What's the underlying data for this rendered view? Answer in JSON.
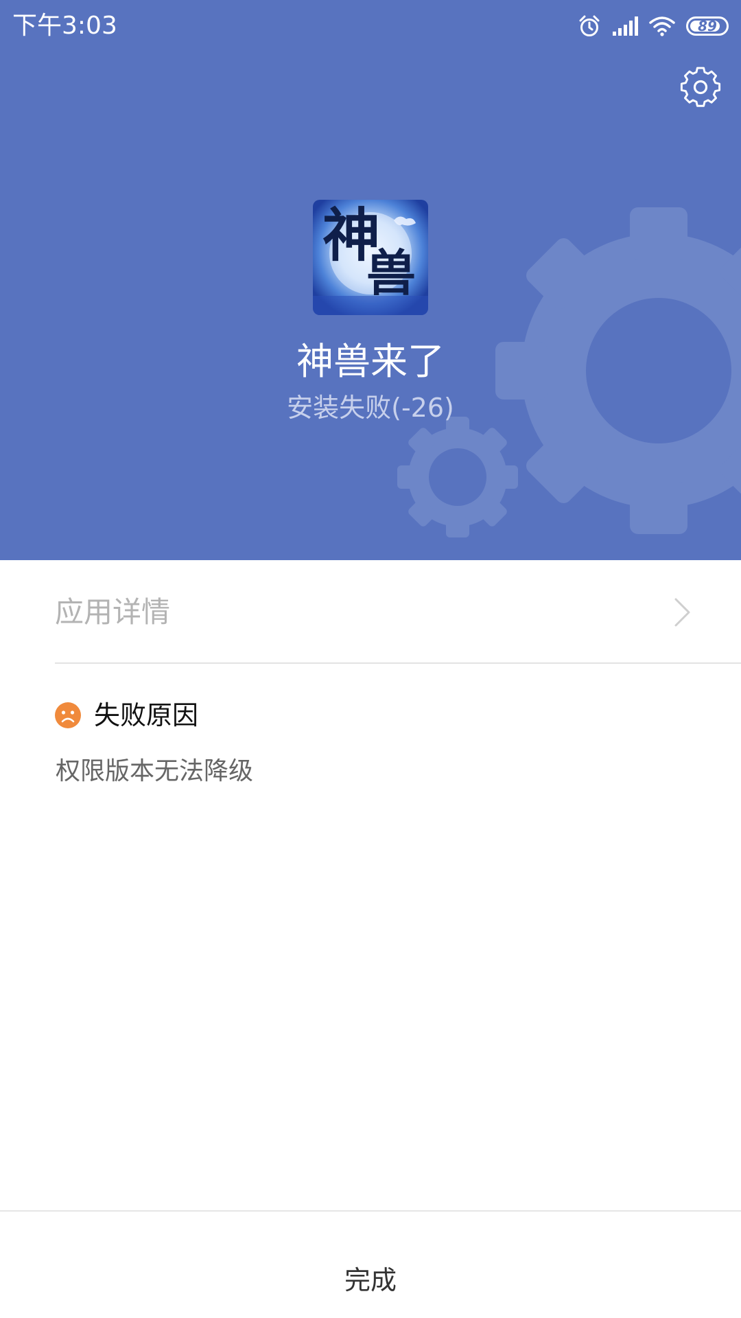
{
  "status_bar": {
    "time": "下午3:03",
    "battery_level": "89",
    "icons": [
      "alarm-icon",
      "signal-icon",
      "wifi-icon",
      "battery-icon"
    ]
  },
  "header": {
    "background_color": "#5873bf",
    "settings_icon": "gear-icon",
    "app_name": "神兽来了",
    "install_status": "安装失败(-26)",
    "app_icon": {
      "characters": [
        "神",
        "兽"
      ]
    }
  },
  "details": {
    "label": "应用详情",
    "chevron_icon": "chevron-right-icon"
  },
  "failure": {
    "icon": "sad-face-icon",
    "icon_color": "#f08a3c",
    "title": "失败原因",
    "reason": "权限版本无法降级"
  },
  "footer": {
    "done_label": "完成"
  }
}
